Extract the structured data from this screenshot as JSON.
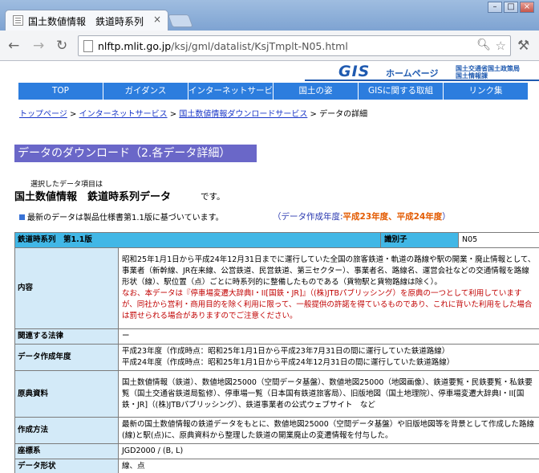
{
  "browser": {
    "tab_title": "国土数値情報　鉄道時系列",
    "tab_close": "×",
    "url_host": "nlftp.mlit.go.jp",
    "url_path": "/ksj/gml/datalist/KsjTmplt-N05.html",
    "icons": [
      "back-icon",
      "forward-icon",
      "reload-icon",
      "page-icon",
      "zoom-icon",
      "star-icon",
      "wrench-icon"
    ]
  },
  "header": {
    "logo_gis": "GIS",
    "logo_home": "ホームページ",
    "org_line1": "国土交通省国土政策局",
    "org_line2": "国土情報課"
  },
  "nav": [
    "TOP",
    "ガイダンス",
    "インターネットサービス",
    "国土の姿",
    "GISに関する取組",
    "リンク集"
  ],
  "breadcrumb": {
    "items": [
      "トップページ",
      "インターネットサービス",
      "国土数値情報ダウンロードサービス"
    ],
    "sep": ">",
    "current": "データの詳細"
  },
  "section_heading": "データのダウンロード（2.各データ詳細）",
  "selected": {
    "label": "選択したデータ項目は",
    "title": "国土数値情報　鉄道時系列データ",
    "suffix": "です。"
  },
  "spec_note": "最新のデータは製品仕様書第1.1版に基づいています。",
  "spec_date": {
    "prefix": "（データ作成年度:",
    "value": "平成23年度、平成24年度",
    "suffix": "）"
  },
  "table": {
    "series_label": "鉄道時系列　第1.1版",
    "id_label": "識別子",
    "id_value": "N05",
    "rows": [
      {
        "key": "content",
        "label": "内容",
        "text": "昭和25年1月1日から平成24年12月31日までに運行していた全国の旅客鉄道・軌道の路線や駅の開業・廃止情報として、事業者（新幹線、JR在来線、公営鉄道、民営鉄道、第三セクター）、事業者名、路線名、運営会社などの交通情報を路線形状（線）、駅位置（点）ごとに時系列的に整備したものである（貨物駅と貨物路線は除く）。",
        "note": "なお、本データは『停車場変遷大辞典I・II[国鉄・JR]』（(株)JTBパブリッシング）を原典の一つとして利用していますが、同社から営利・商用目的を除く利用に限って、一般提供の許諾を得ているものであり、これに背いた利用をした場合は罰せられる場合がありますのでご注意ください。"
      },
      {
        "key": "law",
        "label": "関連する法律",
        "text": "ー"
      },
      {
        "key": "year",
        "label": "データ作成年度",
        "lines": [
          "平成23年度（作成時点：昭和25年1月1日から平成23年7月31日の間に運行していた鉄道路線）",
          "平成24年度（作成時点：昭和25年1月1日から平成24年12月31日の間に運行していた鉄道路線）"
        ]
      },
      {
        "key": "source",
        "label": "原典資料",
        "text": "国土数値情報（鉄道）、数値地図25000（空間データ基盤）、数値地図25000（地図画像）、鉄道要覧・民鉄要覧・私鉄要覧（国土交通省鉄道局監修）、停車場一覧（日本国有鉄道旅客局）、旧版地図（国土地理院）、停車場変遷大辞典I・II[国鉄・JR]（(株)JTBパブリッシング）、鉄道事業者の公式ウェブサイト　など"
      },
      {
        "key": "method",
        "label": "作成方法",
        "text": "最新の国土数値情報の鉄道データをもとに、数値地図25000（空間データ基盤）や旧版地図等を背景として作成した路線(線)と駅(点)に、原典資料から整理した鉄道の開業廃止の変遷情報を付与した。"
      },
      {
        "key": "crs",
        "label": "座標系",
        "text": "JGD2000 / (B, L)"
      },
      {
        "key": "shape",
        "label": "データ形状",
        "text": "線、点"
      }
    ]
  }
}
